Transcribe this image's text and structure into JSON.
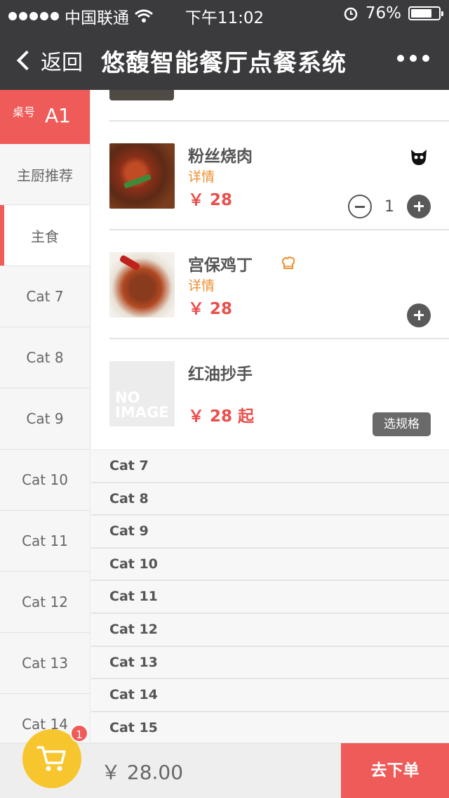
{
  "statusbar": {
    "carrier": "中国联通",
    "time": "下午11:02",
    "battery": "76%",
    "battery_level": 0.76
  },
  "nav": {
    "back_label": "返回",
    "title": "悠馥智能餐厅点餐系统"
  },
  "sidebar": {
    "table_label": "桌号",
    "table_value": "A1",
    "categories": [
      {
        "label": "主厨推荐"
      },
      {
        "label": "主食",
        "active": true
      },
      {
        "label": "Cat 7"
      },
      {
        "label": "Cat 8"
      },
      {
        "label": "Cat 9"
      },
      {
        "label": "Cat 10"
      },
      {
        "label": "Cat 11"
      },
      {
        "label": "Cat 12"
      },
      {
        "label": "Cat 13"
      },
      {
        "label": "Cat 14"
      }
    ]
  },
  "dishes": [
    {
      "name": "粉丝烧肉",
      "detail": "详情",
      "price": "￥ 28",
      "quantity": "1",
      "icon": "black-cat-icon"
    },
    {
      "name": "宫保鸡丁",
      "detail": "详情",
      "price": "￥ 28",
      "icon": "chef-hat-icon"
    },
    {
      "name": "红油抄手",
      "price": "￥ 28 起",
      "spec_button": "选规格",
      "image_placeholder": "NO IMAGE"
    }
  ],
  "category_headers": [
    "Cat 7",
    "Cat 8",
    "Cat 9",
    "Cat 10",
    "Cat 11",
    "Cat 12",
    "Cat 13",
    "Cat 14",
    "Cat 15"
  ],
  "cart": {
    "badge": "1",
    "total": "￥ 28.00",
    "checkout_label": "去下单"
  },
  "colors": {
    "accent": "#ef5b59",
    "nav_bg": "#3b3b3e",
    "cart_yellow": "#f7c62f",
    "detail_orange": "#ee8f30"
  }
}
